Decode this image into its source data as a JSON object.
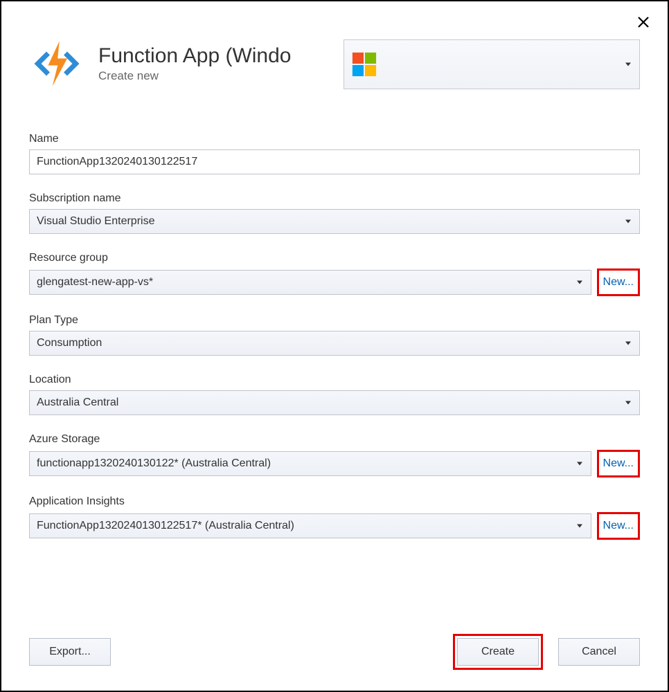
{
  "header": {
    "title": "Function App (Windo",
    "subtitle": "Create new"
  },
  "fields": {
    "name": {
      "label": "Name",
      "value": "FunctionApp1320240130122517"
    },
    "subscription": {
      "label": "Subscription name",
      "value": "Visual Studio Enterprise"
    },
    "resourceGroup": {
      "label": "Resource group",
      "value": "glengatest-new-app-vs*",
      "newLabel": "New..."
    },
    "planType": {
      "label": "Plan Type",
      "value": "Consumption"
    },
    "location": {
      "label": "Location",
      "value": "Australia Central"
    },
    "storage": {
      "label": "Azure Storage",
      "value": "functionapp1320240130122* (Australia Central)",
      "newLabel": "New..."
    },
    "appInsights": {
      "label": "Application Insights",
      "value": "FunctionApp1320240130122517* (Australia Central)",
      "newLabel": "New..."
    }
  },
  "buttons": {
    "export": "Export...",
    "create": "Create",
    "cancel": "Cancel"
  }
}
